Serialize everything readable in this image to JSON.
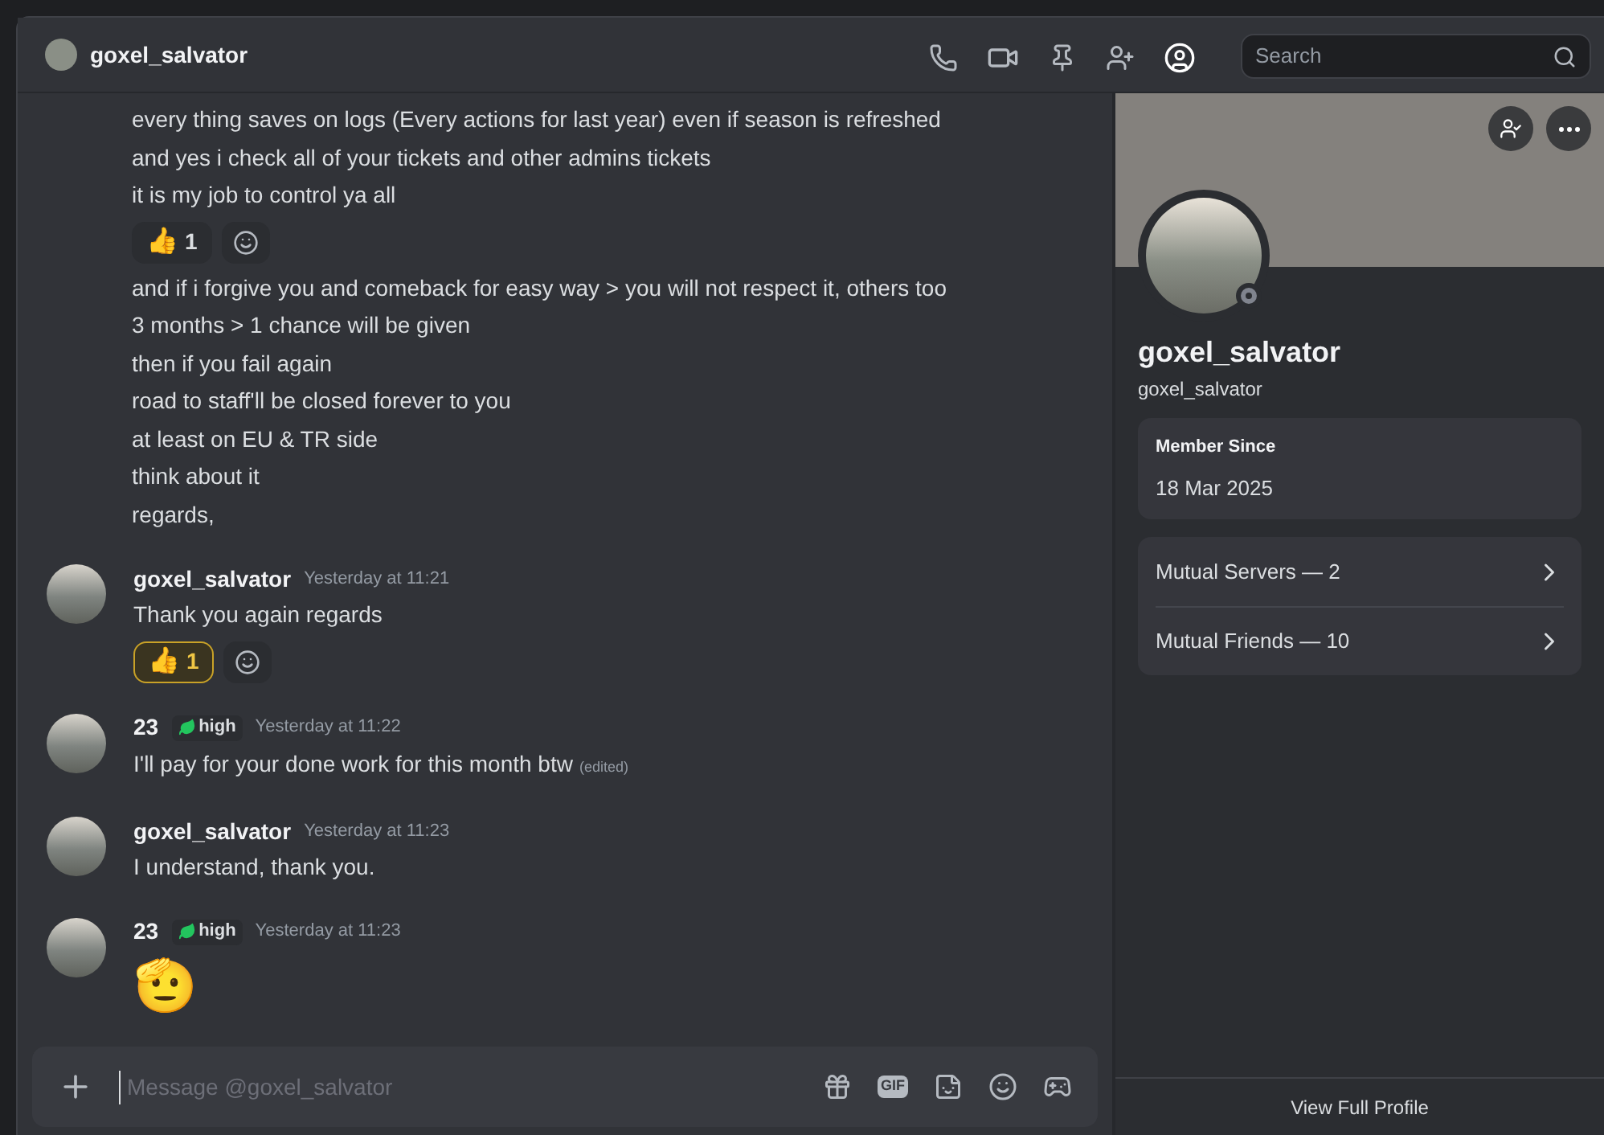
{
  "header": {
    "name": "goxel_salvator",
    "search": {
      "placeholder": "Search"
    }
  },
  "messages": [
    {
      "kind": "continuation",
      "lines": [
        "every thing saves on logs (Every actions for last year) even if season is refreshed",
        "and yes i check all of your tickets and other admins tickets",
        "it is my job to control ya all"
      ],
      "reactions": [
        {
          "emoji": "👍",
          "count": "1",
          "selected": false
        }
      ]
    },
    {
      "kind": "continuation",
      "lines": [
        "and if i forgive you and comeback for easy way > you will not respect it, others too",
        "3 months > 1 chance will be given",
        "then if you fail again",
        "road to staff'll be closed forever to you",
        "at least on EU & TR side",
        "think about it",
        "regards,"
      ]
    },
    {
      "kind": "message",
      "author": "goxel_salvator",
      "time": "Yesterday at 11:21",
      "lines": [
        "Thank you again regards"
      ],
      "reactions": [
        {
          "emoji": "👍",
          "count": "1",
          "selected": true
        }
      ]
    },
    {
      "kind": "message",
      "author": "23",
      "badge": "high",
      "time": "Yesterday at 11:22",
      "lines": [
        "I'll pay for your done work for this month btw"
      ],
      "edited": "(edited)"
    },
    {
      "kind": "message",
      "author": "goxel_salvator",
      "time": "Yesterday at 11:23",
      "lines": [
        "I understand, thank you."
      ]
    },
    {
      "kind": "emoji",
      "author": "23",
      "badge": "high",
      "time": "Yesterday at 11:23",
      "emoji": "🫡"
    }
  ],
  "composer": {
    "placeholder": "Message @goxel_salvator",
    "gif": "GIF"
  },
  "profile": {
    "display_name": "goxel_salvator",
    "username": "goxel_salvator",
    "member_since_label": "Member Since",
    "member_since": "18 Mar 2025",
    "links": [
      "Mutual Servers — 2",
      "Mutual Friends — 10"
    ],
    "footer": "View Full Profile"
  }
}
